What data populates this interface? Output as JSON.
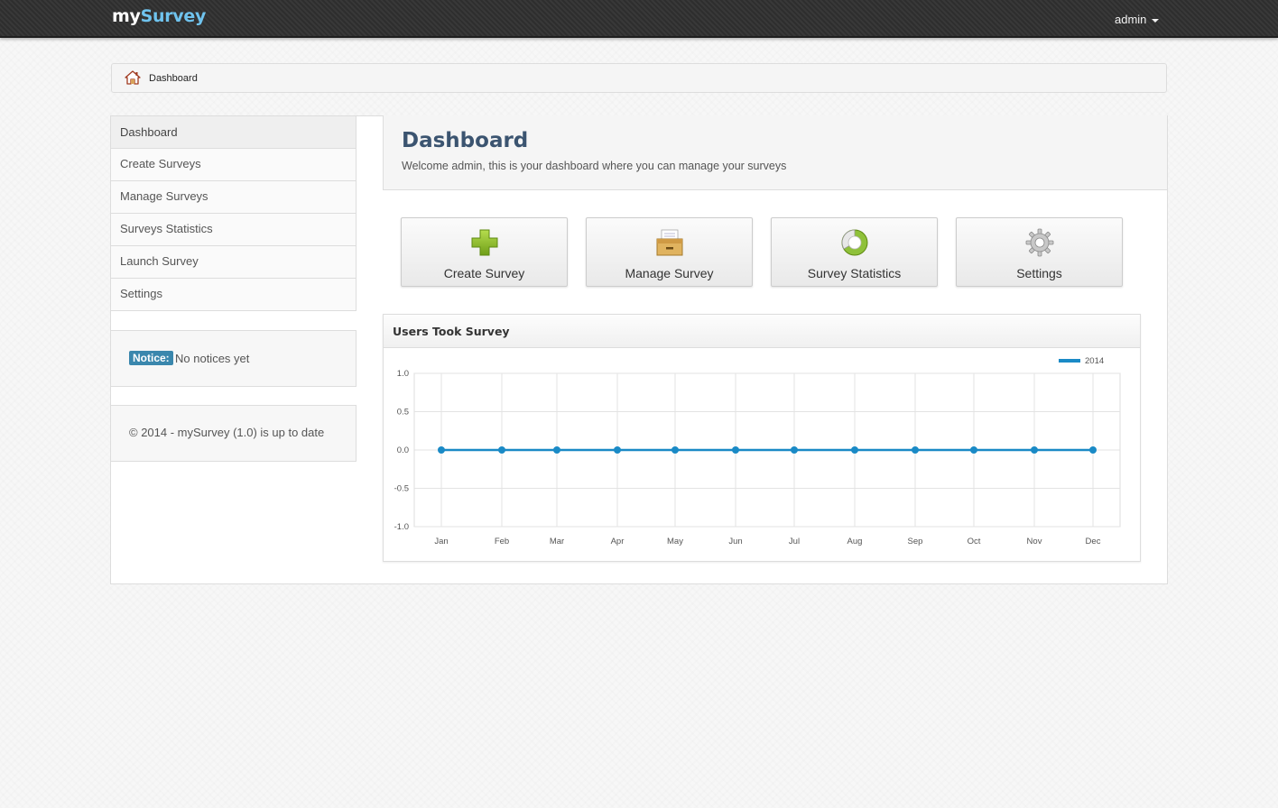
{
  "navbar": {
    "brand_part1": "my",
    "brand_part2": "Survey",
    "user": "admin"
  },
  "breadcrumb": {
    "icon": "home-icon",
    "label": "Dashboard"
  },
  "sidebar": {
    "items": [
      {
        "label": "Dashboard",
        "active": true
      },
      {
        "label": "Create Surveys",
        "active": false
      },
      {
        "label": "Manage Surveys",
        "active": false
      },
      {
        "label": "Surveys Statistics",
        "active": false
      },
      {
        "label": "Launch Survey",
        "active": false
      },
      {
        "label": "Settings",
        "active": false
      }
    ],
    "notice": {
      "label": "Notice:",
      "text": "No notices yet"
    },
    "footer": "© 2014 - mySurvey (1.0) is up to date"
  },
  "header": {
    "title": "Dashboard",
    "subtitle": "Welcome admin, this is your dashboard where you can manage your surveys"
  },
  "shortcuts": [
    {
      "label": "Create Survey",
      "icon": "plus-icon"
    },
    {
      "label": "Manage Survey",
      "icon": "archive-box-icon"
    },
    {
      "label": "Survey Statistics",
      "icon": "pie-chart-icon"
    },
    {
      "label": "Settings",
      "icon": "gear-icon"
    }
  ],
  "widget": {
    "title": "Users Took Survey"
  },
  "colors": {
    "series": "#1a8ac6",
    "accent": "#3a87ad",
    "title": "#3b5470",
    "brand_accent": "#6fc3ee"
  },
  "chart_data": {
    "type": "line",
    "title": "Users Took Survey",
    "xlabel": "",
    "ylabel": "",
    "categories": [
      "Jan",
      "Feb",
      "Mar",
      "Apr",
      "May",
      "Jun",
      "Jul",
      "Aug",
      "Sep",
      "Oct",
      "Nov",
      "Dec"
    ],
    "yticks": [
      "1.0",
      "0.5",
      "0.0",
      "-0.5",
      "-1.0"
    ],
    "ylim": [
      -1,
      1
    ],
    "grid": true,
    "legend": "top-right",
    "series": [
      {
        "name": "2014",
        "values": [
          0,
          0,
          0,
          0,
          0,
          0,
          0,
          0,
          0,
          0,
          0,
          0
        ]
      }
    ]
  }
}
